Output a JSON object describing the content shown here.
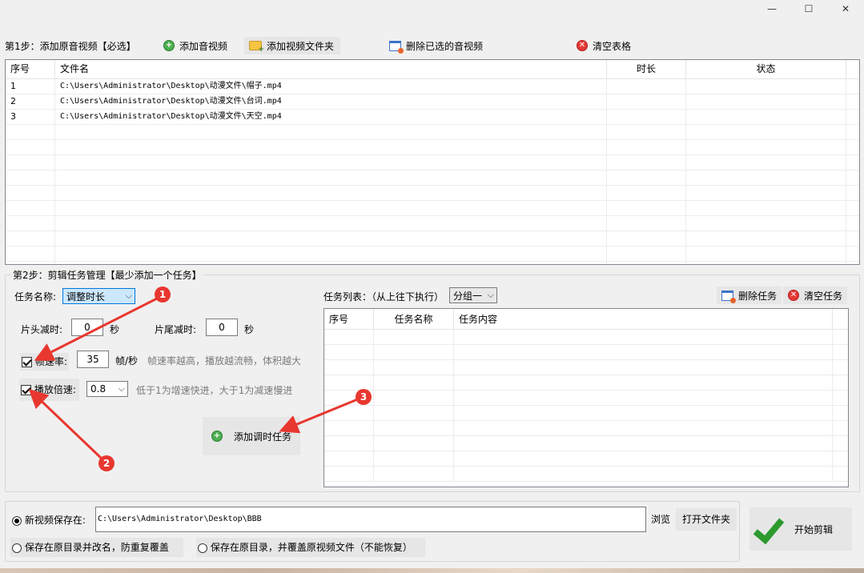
{
  "window": {
    "min": "—",
    "max": "☐",
    "close": "✕"
  },
  "step1": {
    "label": "第1步：添加原音视频【必选】",
    "add_video": "添加音视频",
    "add_folder": "添加视频文件夹",
    "delete_selected": "删除已选的音视频",
    "clear_table": "清空表格"
  },
  "file_table": {
    "headers": {
      "no": "序号",
      "name": "文件名",
      "duration": "时长",
      "status": "状态"
    },
    "rows": [
      {
        "no": "1",
        "name": "C:\\Users\\Administrator\\Desktop\\动漫文件\\帽子.mp4"
      },
      {
        "no": "2",
        "name": "C:\\Users\\Administrator\\Desktop\\动漫文件\\台词.mp4"
      },
      {
        "no": "3",
        "name": "C:\\Users\\Administrator\\Desktop\\动漫文件\\天空.mp4"
      }
    ]
  },
  "step2": {
    "label": "第2步：剪辑任务管理【最少添加一个任务】",
    "task_name_label": "任务名称:",
    "task_name_value": "调整时长",
    "head_cut_label": "片头减时:",
    "head_cut_value": "0",
    "tail_cut_label": "片尾减时:",
    "tail_cut_value": "0",
    "unit_sec": "秒",
    "fps_label": "帧速率:",
    "fps_value": "35",
    "fps_unit": "帧/秒",
    "fps_hint": "帧速率越高，播放越流畅，体积越大",
    "speed_label": "播放倍速:",
    "speed_value": "0.8",
    "speed_hint": "低于1为增速快进，大于1为减速慢进",
    "add_task": "添加调时任务",
    "task_list_label": "任务列表：（从上往下执行）",
    "group_value": "分组一",
    "delete_task": "删除任务",
    "clear_tasks": "清空任务",
    "task_headers": {
      "no": "序号",
      "name": "任务名称",
      "content": "任务内容"
    }
  },
  "output": {
    "new_save_label": "新视频保存在:",
    "path": "C:\\Users\\Administrator\\Desktop\\BBB",
    "browse": "浏览",
    "open_folder": "打开文件夹",
    "opt_rename": "保存在原目录并改名，防重复覆盖",
    "opt_overwrite": "保存在原目录，并覆盖原视频文件（不能恢复）",
    "start": "开始剪辑"
  },
  "annotations": [
    "1",
    "2",
    "3"
  ]
}
